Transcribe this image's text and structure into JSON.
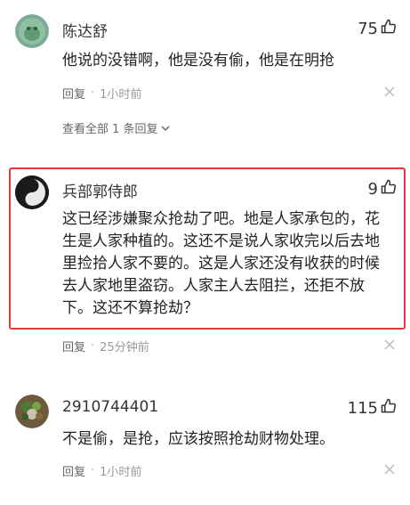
{
  "comments": [
    {
      "username": "陈达舒",
      "likes": "75",
      "lines": [
        "他说的没错啊，他是没有偷，他是在明抢"
      ],
      "reply_label": "回复",
      "time": "1小时前",
      "expand_label": "查看全部 1 条回复"
    },
    {
      "username": "兵部郭侍郎",
      "likes": "9",
      "lines": [
        "这已经涉嫌聚众抢劫了吧。地是人家承包的，花",
        "生是人家种植的。这还不是说人家收完以后去地",
        "里捡拾人家不要的。这是人家还没有收获的时候",
        "去人家地里盗窃。人家主人去阻拦，还拒不放",
        "下。这还不算抢劫？"
      ],
      "reply_label": "回复",
      "time": "25分钟前"
    },
    {
      "username": "2910744401",
      "likes": "115",
      "lines": [
        "不是偷，是抢，应该按照抢劫财物处理。"
      ],
      "reply_label": "回复",
      "time": "1小时前"
    }
  ],
  "icons": {
    "like": "thumbs-up-icon",
    "close": "close-icon",
    "expand": "chevron-down-icon"
  },
  "colors": {
    "highlight_border": "#e53935",
    "meta_text": "#999999"
  }
}
